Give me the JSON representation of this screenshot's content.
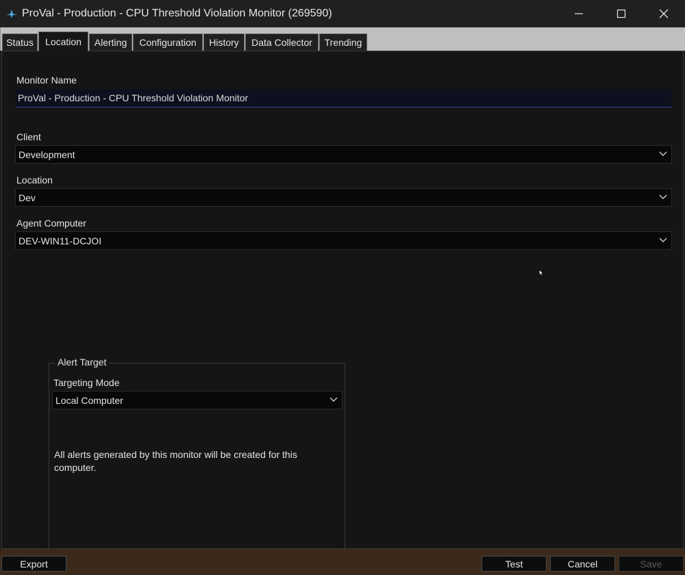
{
  "window": {
    "title": "ProVal - Production - CPU Threshold Violation Monitor (269590)",
    "icons": {
      "app": "app-logo-icon",
      "minimize": "minimize-icon",
      "maximize": "maximize-icon",
      "close": "close-icon"
    }
  },
  "tabs": [
    {
      "label": "Status",
      "active": false
    },
    {
      "label": "Location",
      "active": true
    },
    {
      "label": "Alerting",
      "active": false
    },
    {
      "label": "Configuration",
      "active": false
    },
    {
      "label": "History",
      "active": false
    },
    {
      "label": "Data Collector",
      "active": false
    },
    {
      "label": "Trending",
      "active": false
    }
  ],
  "form": {
    "monitor_name_label": "Monitor Name",
    "monitor_name_value": "ProVal - Production - CPU Threshold Violation Monitor",
    "client_label": "Client",
    "client_value": "Development",
    "location_label": "Location",
    "location_value": "Dev",
    "agent_label": "Agent Computer",
    "agent_value": "DEV-WIN11-DCJOI"
  },
  "alert_target": {
    "group_title": "Alert Target",
    "mode_label": "Targeting Mode",
    "mode_value": "Local Computer",
    "note_line1": "All alerts generated by this monitor will be created for this",
    "note_line2": "computer."
  },
  "buttons": {
    "export": "Export",
    "test": "Test",
    "cancel": "Cancel",
    "save": "Save",
    "save_disabled": true
  },
  "colors": {
    "background": "#151515",
    "titlebar": "#202020",
    "bottombar": "#3b2a1b",
    "accent_icon": "#4fa3e0"
  }
}
